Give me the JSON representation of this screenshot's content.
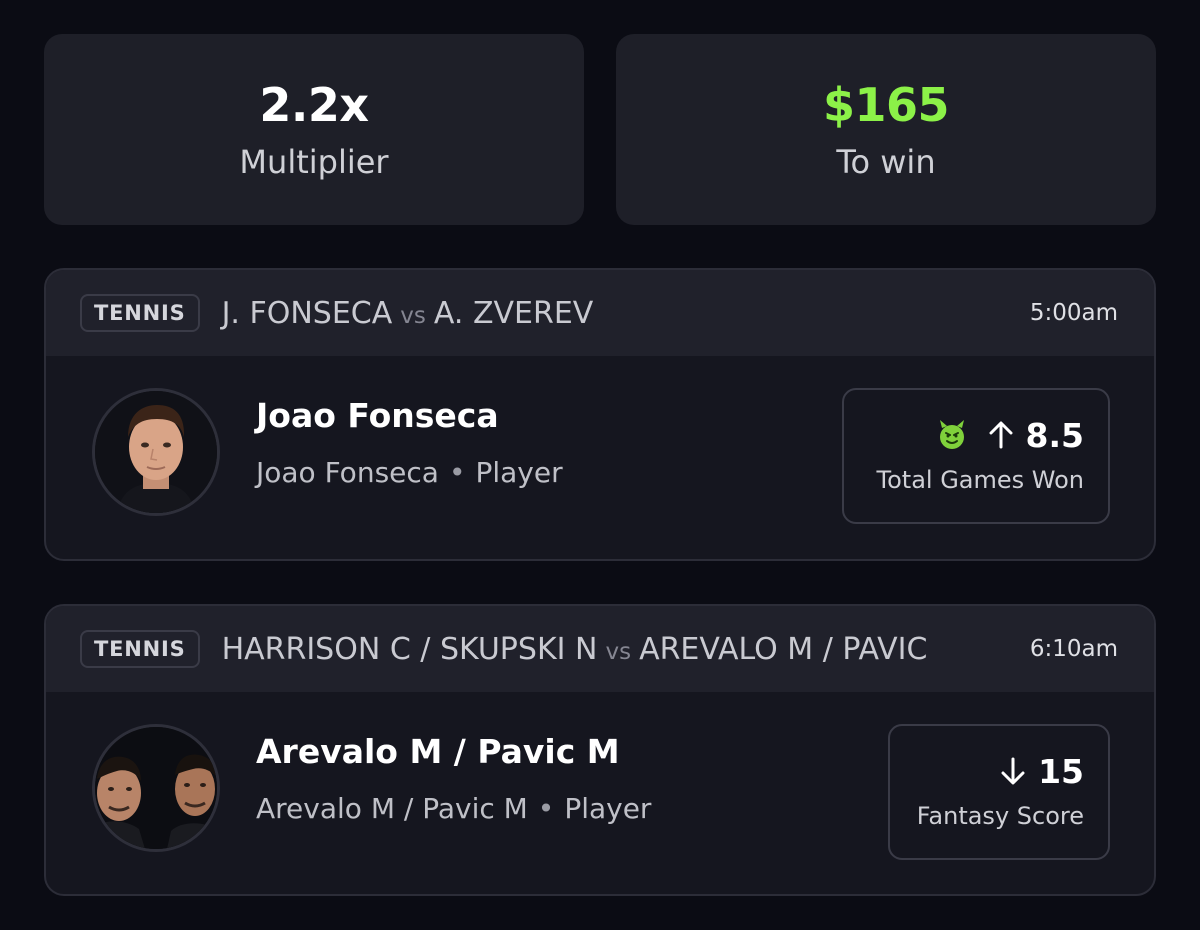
{
  "summary": {
    "multiplier": {
      "value": "2.2x",
      "label": "Multiplier"
    },
    "to_win": {
      "value": "$165",
      "label": "To win"
    }
  },
  "picks": [
    {
      "sport": "TENNIS",
      "team_a": "J. FONSECA",
      "vs": "vs",
      "team_b": "A. ZVEREV",
      "time": "5:00am",
      "player_name": "Joao Fonseca",
      "player_detail": "Joao Fonseca",
      "player_role": "Player",
      "direction": "up",
      "direction_icon": "arrow-up-icon",
      "badge_icon": "green-demon-icon",
      "line": "8.5",
      "stat": "Total Games Won"
    },
    {
      "sport": "TENNIS",
      "team_a": "HARRISON C / SKUPSKI N",
      "vs": "vs",
      "team_b": "AREVALO M / PAVIC",
      "time": "6:10am",
      "player_name": "Arevalo M / Pavic M",
      "player_detail": "Arevalo M / Pavic M",
      "player_role": "Player",
      "direction": "down",
      "direction_icon": "arrow-down-icon",
      "line": "15",
      "stat": "Fantasy Score"
    }
  ],
  "colors": {
    "background": "#0b0c14",
    "card": "#1e1f28",
    "accent_green": "#8cf148"
  }
}
